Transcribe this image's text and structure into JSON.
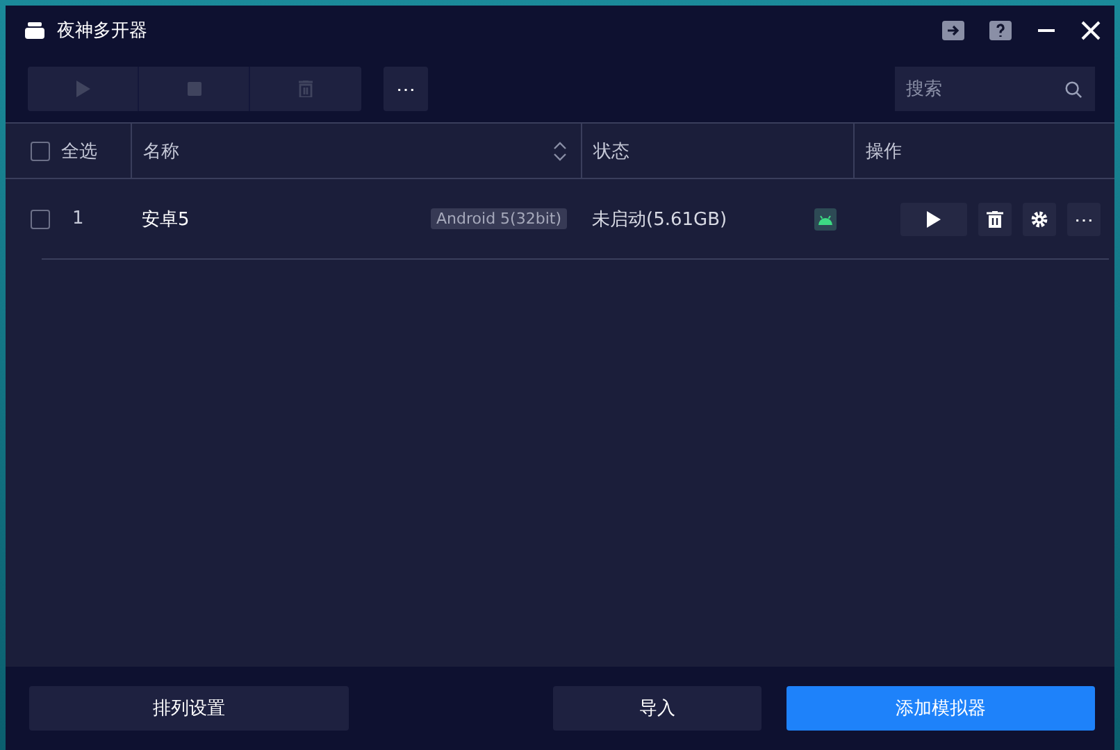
{
  "window": {
    "title": "夜神多开器"
  },
  "toolbar": {
    "buttons": [
      {
        "kind": "play",
        "disabled": true
      },
      {
        "kind": "stop",
        "disabled": true
      },
      {
        "kind": "delete",
        "disabled": true
      }
    ],
    "more": "⋯",
    "search": {
      "placeholder": "搜索"
    }
  },
  "table": {
    "select_all": {
      "label": "全选",
      "checked": false
    },
    "columns": [
      "名称",
      "状态",
      "操作"
    ],
    "rows": [
      {
        "checked": false,
        "index": "1",
        "name": "安卓5",
        "version": "Android 5(32bit)",
        "status": "未启动(5.61GB)",
        "more": "⋯"
      }
    ]
  },
  "footer": {
    "buttons": [
      {
        "label": "排列设置",
        "kind": "secondary"
      },
      {
        "label": "导入",
        "kind": "secondary"
      },
      {
        "label": "添加模拟器",
        "kind": "primary"
      }
    ]
  }
}
